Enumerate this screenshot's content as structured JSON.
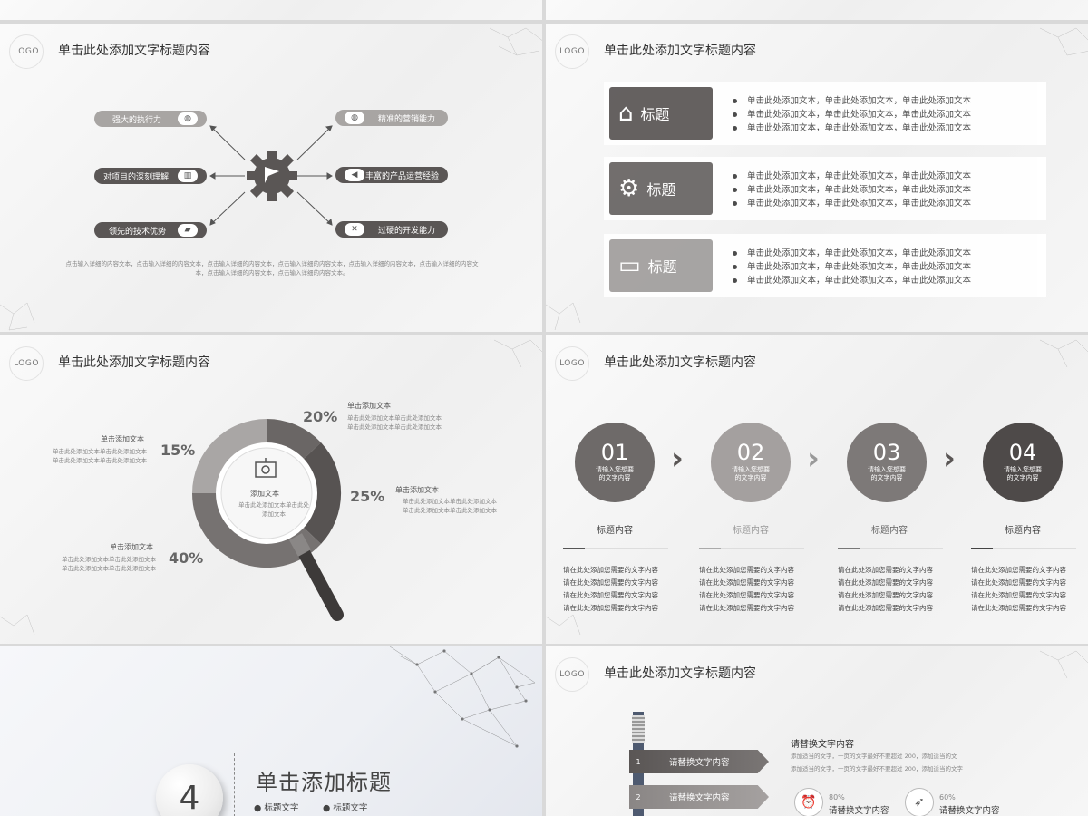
{
  "logo_text": "LOGO",
  "slide_title": "单击此处添加文字标题内容",
  "slide1": {
    "left_items": [
      "强大的执行力",
      "对项目的深刻理解",
      "领先的技术优势"
    ],
    "right_items": [
      "精准的营销能力",
      "丰富的产品运营经验",
      "过硬的开发能力"
    ],
    "footer_line1": "点击输入详细的内容文本，点击输入详细的内容文本，点击输入详细的内容文本，点击输入详细的内容文本，点击输入详细的内容文本，点击输入详细的内容文",
    "footer_line2": "本，点击输入详细的内容文本，点击输入详细的内容文本。"
  },
  "slide2": {
    "rows": [
      {
        "icon": "house-icon",
        "label": "标题",
        "color": "#5e5a59",
        "lines": [
          "单击此处添加文本，单击此处添加文本，单击此处添加文本",
          "单击此处添加文本，单击此处添加文本，单击此处添加文本",
          "单击此处添加文本，单击此处添加文本，单击此处添加文本"
        ]
      },
      {
        "icon": "gears-icon",
        "label": "标题",
        "color": "#6b6766",
        "lines": [
          "单击此处添加文本，单击此处添加文本，单击此处添加文本",
          "单击此处添加文本，单击此处添加文本，单击此处添加文本",
          "单击此处添加文本，单击此处添加文本，单击此处添加文本"
        ]
      },
      {
        "icon": "briefcase-icon",
        "label": "标题",
        "color": "#a3a09f",
        "lines": [
          "单击此处添加文本，单击此处添加文本，单击此处添加文本",
          "单击此处添加文本，单击此处添加文本，单击此处添加文本",
          "单击此处添加文本，单击此处添加文本，单击此处添加文本"
        ]
      }
    ]
  },
  "slide3": {
    "center_title": "添加文本",
    "center_sub": "单击此处添加文本单击此处添加文本",
    "segments": [
      {
        "pct": "20%",
        "head": "单击添加文本",
        "l1": "单击此处添加文本单击此处添加文本",
        "l2": "单击此处添加文本单击此处添加文本"
      },
      {
        "pct": "25%",
        "head": "单击添加文本",
        "l1": "单击此处添加文本单击此处添加文本",
        "l2": "单击此处添加文本单击此处添加文本"
      },
      {
        "pct": "40%",
        "head": "单击添加文本",
        "l1": "单击此处添加文本单击此处添加文本",
        "l2": "单击此处添加文本单击此处添加文本"
      },
      {
        "pct": "15%",
        "head": "单击添加文本",
        "l1": "单击此处添加文本单击此处添加文本",
        "l2": "单击此处添加文本单击此处添加文本"
      }
    ]
  },
  "slide4": {
    "steps": [
      {
        "num": "01",
        "sub1": "请输入您想要",
        "sub2": "的文字内容",
        "head": "标题内容",
        "color": "#6e6a69"
      },
      {
        "num": "02",
        "sub1": "请输入您想要",
        "sub2": "的文字内容",
        "head": "标题内容",
        "color": "#a4a09f"
      },
      {
        "num": "03",
        "sub1": "请输入您想要",
        "sub2": "的文字内容",
        "head": "标题内容",
        "color": "#7d7978"
      },
      {
        "num": "04",
        "sub1": "请输入您想要",
        "sub2": "的文字内容",
        "head": "标题内容",
        "color": "#4e4a49"
      }
    ],
    "body_line": "请在此处添加您需要的文字内容"
  },
  "slide5": {
    "number": "4",
    "title": "单击添加标题",
    "bullets": [
      "标题文字",
      "标题文字"
    ]
  },
  "slide6": {
    "signs": [
      {
        "num": "1",
        "text": "请替换文字内容"
      },
      {
        "num": "2",
        "text": "请替换文字内容"
      }
    ],
    "heading": "请替换文字内容",
    "desc1": "添加适当的文字，一页的文字最好不要超过 200，添加适当的文",
    "desc2": "添加适当的文字，一页的文字最好不要超过 200，添加适当的文字",
    "stats": [
      {
        "icon": "alarm-clock-icon",
        "pct": "80%",
        "text": "请替换文字内容"
      },
      {
        "icon": "rocket-icon",
        "pct": "60%",
        "text": "请替换文字内容"
      }
    ]
  }
}
